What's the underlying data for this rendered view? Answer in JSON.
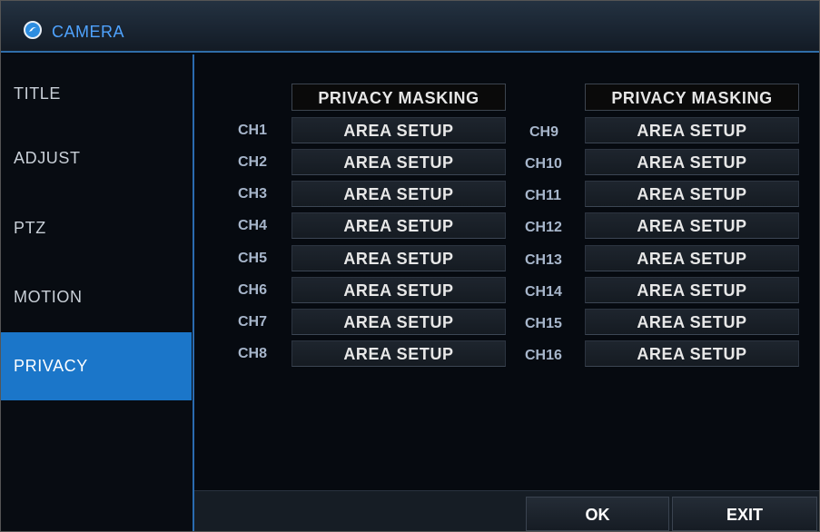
{
  "window": {
    "title": "CAMERA",
    "icon": "camera-logo-icon"
  },
  "sidebar": {
    "items": [
      {
        "label": "TITLE",
        "active": false
      },
      {
        "label": "ADJUST",
        "active": false
      },
      {
        "label": "PTZ",
        "active": false
      },
      {
        "label": "MOTION",
        "active": false
      },
      {
        "label": "PRIVACY",
        "active": true
      }
    ]
  },
  "privacy": {
    "left_header": "PRIVACY MASKING",
    "right_header": "PRIVACY MASKING",
    "button_label": "AREA SETUP",
    "left_channels": [
      "CH1",
      "CH2",
      "CH3",
      "CH4",
      "CH5",
      "CH6",
      "CH7",
      "CH8"
    ],
    "right_channels": [
      "CH9",
      "CH10",
      "CH11",
      "CH12",
      "CH13",
      "CH14",
      "CH15",
      "CH16"
    ]
  },
  "footer": {
    "ok_label": "OK",
    "exit_label": "EXIT"
  },
  "colors": {
    "accent": "#1b76c9",
    "title_text": "#4fa3ff",
    "channel_label": "#a7b6cb"
  }
}
